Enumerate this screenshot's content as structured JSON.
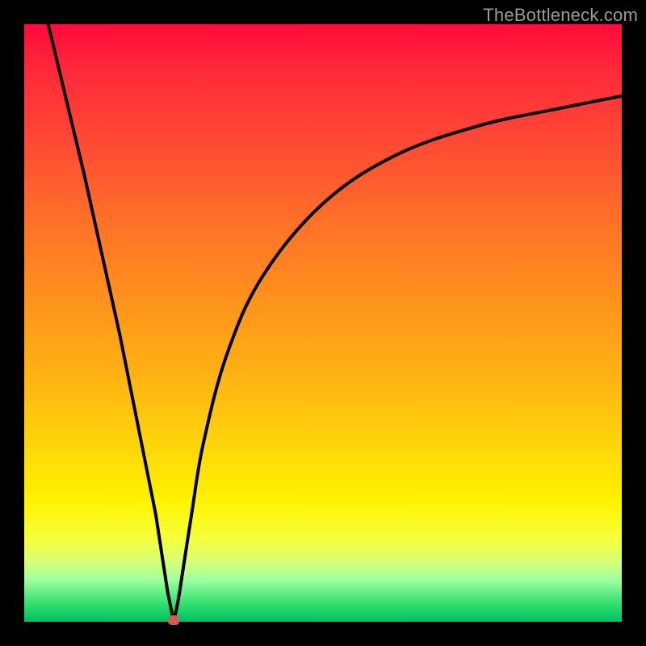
{
  "watermark": "TheBottleneck.com",
  "chart_data": {
    "type": "line",
    "title": "",
    "xlabel": "",
    "ylabel": "",
    "xlim": [
      0,
      100
    ],
    "ylim": [
      0,
      100
    ],
    "grid": false,
    "legend": false,
    "annotations": [],
    "left_branch": {
      "x": [
        4,
        10,
        16,
        22,
        24,
        25
      ],
      "y": [
        100,
        75,
        48,
        18,
        5,
        0
      ]
    },
    "right_branch": {
      "x": [
        25,
        26,
        28,
        30,
        34,
        40,
        50,
        62,
        76,
        90,
        100
      ],
      "y": [
        0,
        5,
        18,
        30,
        45,
        58,
        70,
        78,
        83,
        86,
        88
      ]
    },
    "minimum_point": {
      "x": 25,
      "y": 0
    },
    "background_gradient": {
      "top": "#ff0a3a",
      "mid_upper": "#ff8f1e",
      "mid": "#fff300",
      "mid_lower": "#d6ff7a",
      "bottom": "#00c060"
    }
  }
}
